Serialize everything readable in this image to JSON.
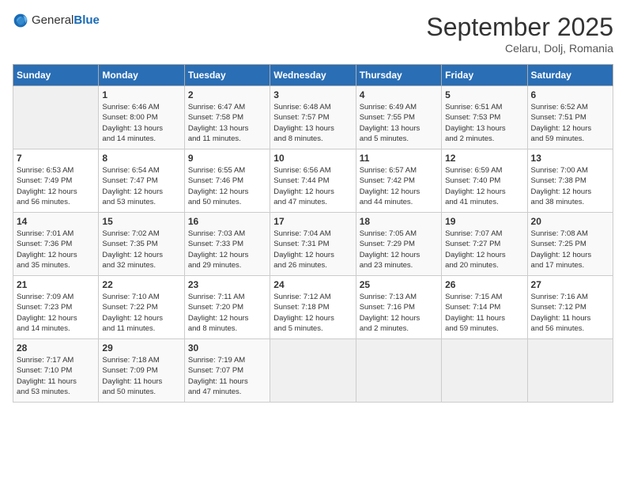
{
  "header": {
    "logo_general": "General",
    "logo_blue": "Blue",
    "month": "September 2025",
    "location": "Celaru, Dolj, Romania"
  },
  "days_of_week": [
    "Sunday",
    "Monday",
    "Tuesday",
    "Wednesday",
    "Thursday",
    "Friday",
    "Saturday"
  ],
  "weeks": [
    [
      {
        "day": "",
        "info": ""
      },
      {
        "day": "1",
        "info": "Sunrise: 6:46 AM\nSunset: 8:00 PM\nDaylight: 13 hours\nand 14 minutes."
      },
      {
        "day": "2",
        "info": "Sunrise: 6:47 AM\nSunset: 7:58 PM\nDaylight: 13 hours\nand 11 minutes."
      },
      {
        "day": "3",
        "info": "Sunrise: 6:48 AM\nSunset: 7:57 PM\nDaylight: 13 hours\nand 8 minutes."
      },
      {
        "day": "4",
        "info": "Sunrise: 6:49 AM\nSunset: 7:55 PM\nDaylight: 13 hours\nand 5 minutes."
      },
      {
        "day": "5",
        "info": "Sunrise: 6:51 AM\nSunset: 7:53 PM\nDaylight: 13 hours\nand 2 minutes."
      },
      {
        "day": "6",
        "info": "Sunrise: 6:52 AM\nSunset: 7:51 PM\nDaylight: 12 hours\nand 59 minutes."
      }
    ],
    [
      {
        "day": "7",
        "info": "Sunrise: 6:53 AM\nSunset: 7:49 PM\nDaylight: 12 hours\nand 56 minutes."
      },
      {
        "day": "8",
        "info": "Sunrise: 6:54 AM\nSunset: 7:47 PM\nDaylight: 12 hours\nand 53 minutes."
      },
      {
        "day": "9",
        "info": "Sunrise: 6:55 AM\nSunset: 7:46 PM\nDaylight: 12 hours\nand 50 minutes."
      },
      {
        "day": "10",
        "info": "Sunrise: 6:56 AM\nSunset: 7:44 PM\nDaylight: 12 hours\nand 47 minutes."
      },
      {
        "day": "11",
        "info": "Sunrise: 6:57 AM\nSunset: 7:42 PM\nDaylight: 12 hours\nand 44 minutes."
      },
      {
        "day": "12",
        "info": "Sunrise: 6:59 AM\nSunset: 7:40 PM\nDaylight: 12 hours\nand 41 minutes."
      },
      {
        "day": "13",
        "info": "Sunrise: 7:00 AM\nSunset: 7:38 PM\nDaylight: 12 hours\nand 38 minutes."
      }
    ],
    [
      {
        "day": "14",
        "info": "Sunrise: 7:01 AM\nSunset: 7:36 PM\nDaylight: 12 hours\nand 35 minutes."
      },
      {
        "day": "15",
        "info": "Sunrise: 7:02 AM\nSunset: 7:35 PM\nDaylight: 12 hours\nand 32 minutes."
      },
      {
        "day": "16",
        "info": "Sunrise: 7:03 AM\nSunset: 7:33 PM\nDaylight: 12 hours\nand 29 minutes."
      },
      {
        "day": "17",
        "info": "Sunrise: 7:04 AM\nSunset: 7:31 PM\nDaylight: 12 hours\nand 26 minutes."
      },
      {
        "day": "18",
        "info": "Sunrise: 7:05 AM\nSunset: 7:29 PM\nDaylight: 12 hours\nand 23 minutes."
      },
      {
        "day": "19",
        "info": "Sunrise: 7:07 AM\nSunset: 7:27 PM\nDaylight: 12 hours\nand 20 minutes."
      },
      {
        "day": "20",
        "info": "Sunrise: 7:08 AM\nSunset: 7:25 PM\nDaylight: 12 hours\nand 17 minutes."
      }
    ],
    [
      {
        "day": "21",
        "info": "Sunrise: 7:09 AM\nSunset: 7:23 PM\nDaylight: 12 hours\nand 14 minutes."
      },
      {
        "day": "22",
        "info": "Sunrise: 7:10 AM\nSunset: 7:22 PM\nDaylight: 12 hours\nand 11 minutes."
      },
      {
        "day": "23",
        "info": "Sunrise: 7:11 AM\nSunset: 7:20 PM\nDaylight: 12 hours\nand 8 minutes."
      },
      {
        "day": "24",
        "info": "Sunrise: 7:12 AM\nSunset: 7:18 PM\nDaylight: 12 hours\nand 5 minutes."
      },
      {
        "day": "25",
        "info": "Sunrise: 7:13 AM\nSunset: 7:16 PM\nDaylight: 12 hours\nand 2 minutes."
      },
      {
        "day": "26",
        "info": "Sunrise: 7:15 AM\nSunset: 7:14 PM\nDaylight: 11 hours\nand 59 minutes."
      },
      {
        "day": "27",
        "info": "Sunrise: 7:16 AM\nSunset: 7:12 PM\nDaylight: 11 hours\nand 56 minutes."
      }
    ],
    [
      {
        "day": "28",
        "info": "Sunrise: 7:17 AM\nSunset: 7:10 PM\nDaylight: 11 hours\nand 53 minutes."
      },
      {
        "day": "29",
        "info": "Sunrise: 7:18 AM\nSunset: 7:09 PM\nDaylight: 11 hours\nand 50 minutes."
      },
      {
        "day": "30",
        "info": "Sunrise: 7:19 AM\nSunset: 7:07 PM\nDaylight: 11 hours\nand 47 minutes."
      },
      {
        "day": "",
        "info": ""
      },
      {
        "day": "",
        "info": ""
      },
      {
        "day": "",
        "info": ""
      },
      {
        "day": "",
        "info": ""
      }
    ]
  ]
}
